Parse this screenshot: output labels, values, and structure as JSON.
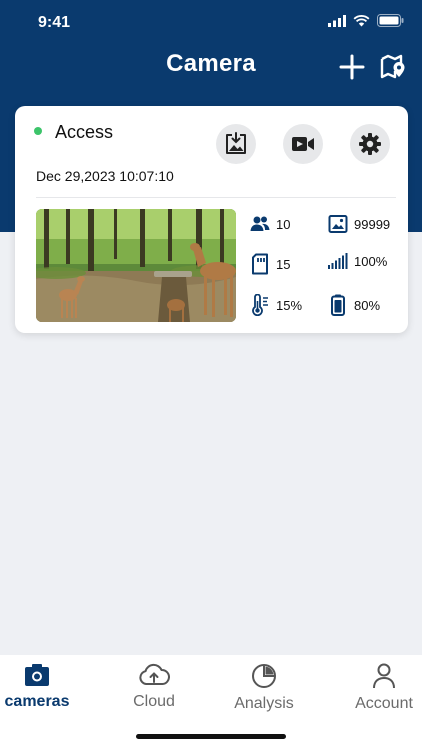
{
  "status_bar": {
    "time": "9:41"
  },
  "header": {
    "title": "Camera"
  },
  "camera_card": {
    "name": "Access",
    "online": true,
    "datetime": "Dec 29,2023 10:07:10",
    "stats": {
      "people": "10",
      "photos": "99999",
      "sd_card": "15",
      "signal": "100%",
      "temperature": "15%",
      "battery": "80%"
    }
  },
  "tabs": [
    {
      "label": "cameras",
      "icon": "camera-icon",
      "active": true
    },
    {
      "label": "Cloud",
      "icon": "cloud-upload-icon",
      "active": false
    },
    {
      "label": "Analysis",
      "icon": "pie-chart-icon",
      "active": false
    },
    {
      "label": "Account",
      "icon": "person-icon",
      "active": false
    }
  ],
  "colors": {
    "brand": "#0a3a6e",
    "online": "#3cc46a",
    "background": "#eef0f4"
  }
}
